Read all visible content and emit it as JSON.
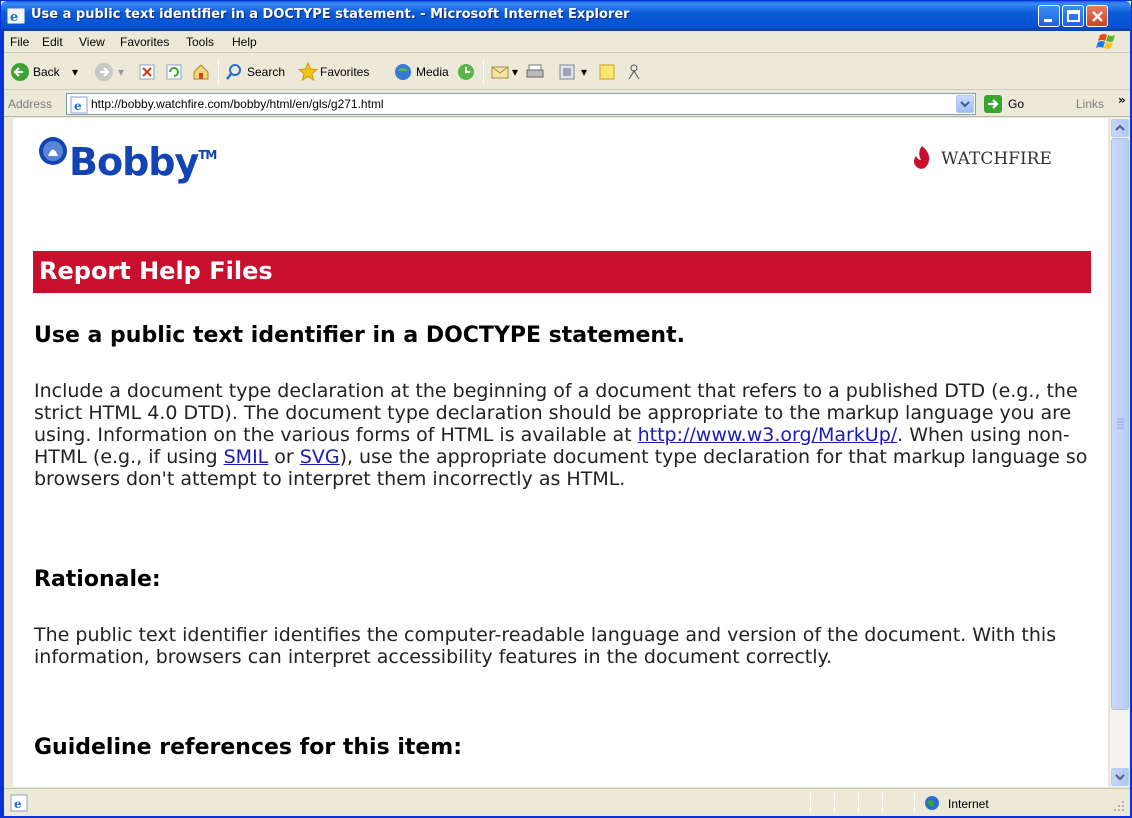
{
  "window": {
    "title": "Use a public text identifier in a DOCTYPE statement. - Microsoft Internet Explorer"
  },
  "menu": {
    "items": [
      "File",
      "Edit",
      "View",
      "Favorites",
      "Tools",
      "Help"
    ]
  },
  "toolbar": {
    "back_label": "Back",
    "search_label": "Search",
    "favorites_label": "Favorites",
    "media_label": "Media"
  },
  "address": {
    "label": "Address",
    "url": "http://bobby.watchfire.com/bobby/html/en/gls/g271.html",
    "go_label": "Go",
    "links_label": "Links",
    "links_chevron": "»"
  },
  "page": {
    "logo_text": "Bobby",
    "logo_tm": "TM",
    "brand_text": "watchfire",
    "banner_title": "Report Help Files",
    "heading": "Use a public text identifier in a DOCTYPE statement.",
    "para1_a": "Include a document type declaration at the beginning of a document that refers to a published DTD (e.g., the strict HTML 4.0 DTD). The document type declaration should be appropriate to the markup language you are using. Information on the various forms of HTML is available at ",
    "para1_link": "http://www.w3.org/MarkUp/",
    "para1_b": ". When using non-HTML (e.g., if using ",
    "para1_smil": "SMIL",
    "para1_or": " or ",
    "para1_svg": "SVG",
    "para1_c": "), use the appropriate document type declaration for that markup language so browsers don't attempt to interpret them incorrectly as HTML.",
    "rationale_heading": "Rationale:",
    "rationale_text": "The public text identifier identifies the computer-readable language and version of the document. With this information, browsers can interpret accessibility features in the document correctly.",
    "guideline_heading": "Guideline references for this item:"
  },
  "status": {
    "zone": "Internet"
  },
  "colors": {
    "banner": "#c8102e",
    "logo_blue": "#1244b4",
    "link": "#1a1ab8",
    "titlebar": "#0b5bd9"
  }
}
